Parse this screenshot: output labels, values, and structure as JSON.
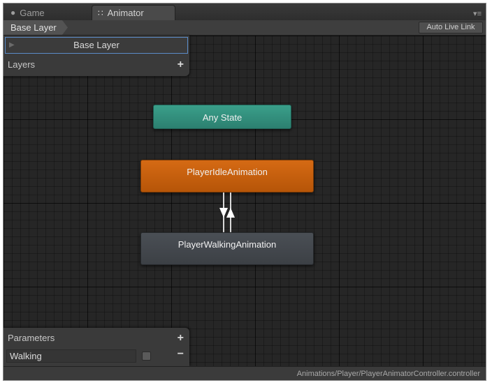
{
  "tabs": [
    {
      "label": "Game",
      "icon": "pacman-icon"
    },
    {
      "label": "Animator",
      "icon": "animator-icon"
    }
  ],
  "toolbar": {
    "breadcrumb": "Base Layer",
    "auto_live_link": "Auto Live Link"
  },
  "layers": {
    "header": "Layers",
    "items": [
      {
        "label": "Base Layer"
      }
    ]
  },
  "states": {
    "any": {
      "label": "Any State",
      "color": "#2f8b7a"
    },
    "idle": {
      "label": "PlayerIdleAnimation",
      "color": "#c85f0c"
    },
    "walking": {
      "label": "PlayerWalkingAnimation",
      "color": "#43474c"
    }
  },
  "parameters": {
    "header": "Parameters",
    "items": [
      {
        "name": "Walking",
        "type": "bool",
        "checked": false
      }
    ]
  },
  "status": {
    "path": "Animations/Player/PlayerAnimatorController.controller"
  }
}
